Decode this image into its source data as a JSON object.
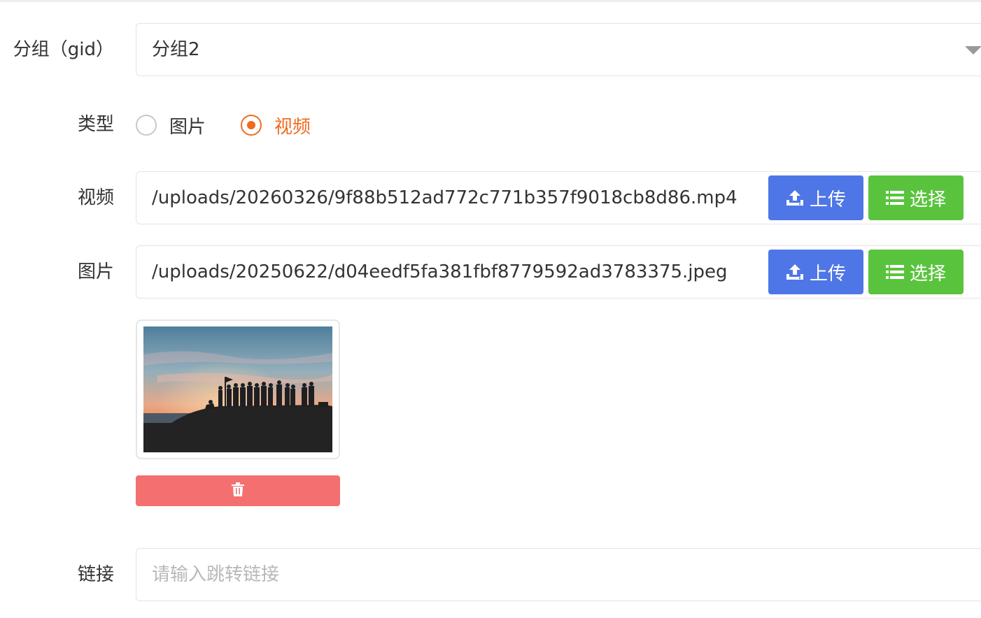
{
  "form": {
    "group": {
      "label": "分组（gid）",
      "value": "分组2"
    },
    "type": {
      "label": "类型",
      "options": [
        {
          "label": "图片",
          "checked": false
        },
        {
          "label": "视频",
          "checked": true
        }
      ]
    },
    "video": {
      "label": "视频",
      "value": "/uploads/20260326/9f88b512ad772c771b357f9018cb8d86.mp4",
      "upload_label": "上传",
      "select_label": "选择"
    },
    "image": {
      "label": "图片",
      "value": "/uploads/20250622/d04eedf5fa381fbf8779592ad3783375.jpeg",
      "upload_label": "上传",
      "select_label": "选择"
    },
    "link": {
      "label": "链接",
      "value": "",
      "placeholder": "请输入跳转链接"
    }
  },
  "icons": {
    "upload": "upload-icon",
    "select": "list-icon",
    "delete": "trash-icon",
    "dropdown": "caret-down-icon"
  },
  "colors": {
    "accent": "#ef6b1e",
    "upload_button": "#4f76e6",
    "select_button": "#5ac33e",
    "delete_button": "#f46f6f"
  }
}
